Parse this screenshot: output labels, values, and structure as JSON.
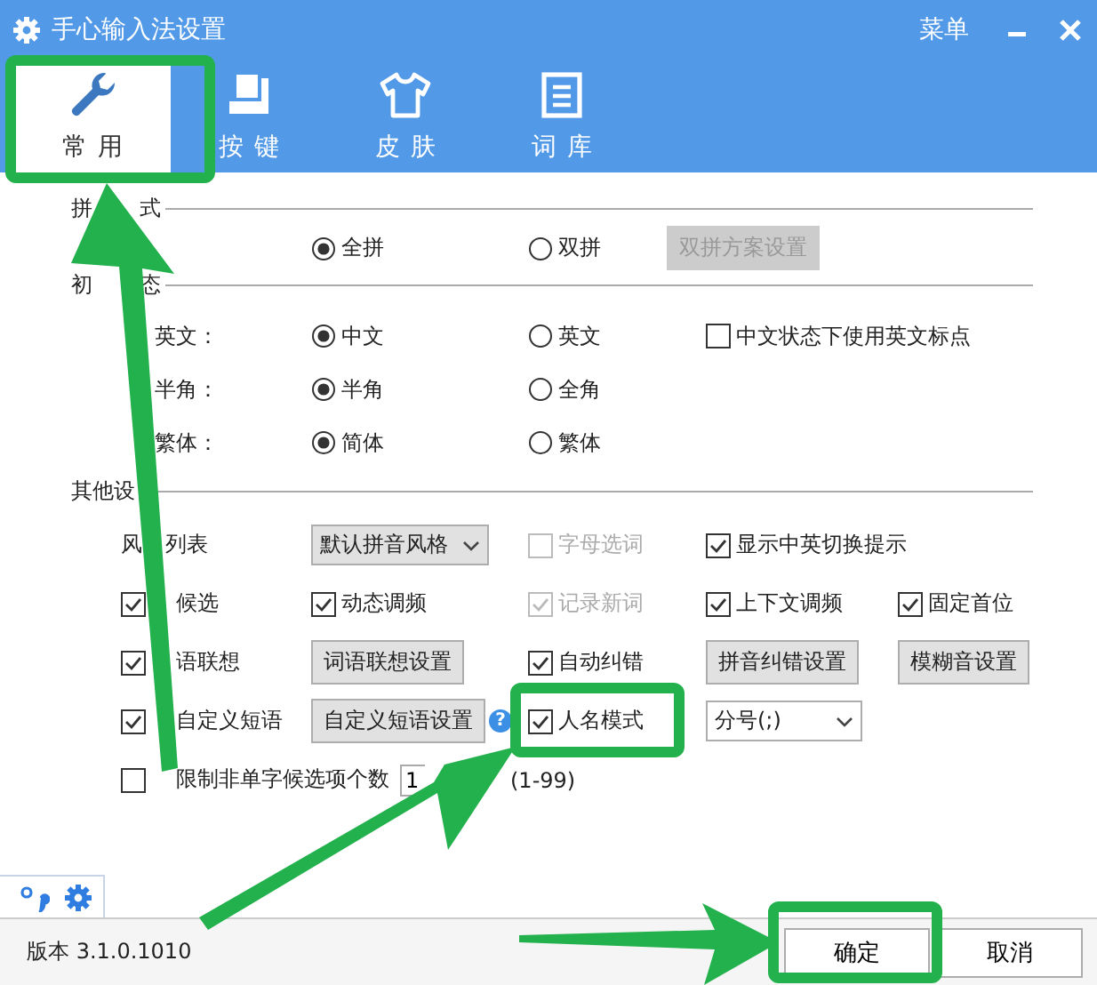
{
  "window": {
    "title": "手心输入法设置",
    "menu": "菜单"
  },
  "tabs": [
    {
      "label": "常用",
      "selected": true
    },
    {
      "label": "按键",
      "selected": false
    },
    {
      "label": "皮肤",
      "selected": false
    },
    {
      "label": "词库",
      "selected": false
    }
  ],
  "sections": [
    {
      "title": [
        "拼",
        "式"
      ],
      "rows": [
        {
          "cells": [
            {
              "kind": "radio",
              "label": "全拼",
              "selected": true
            },
            {
              "kind": "radio",
              "label": "双拼",
              "selected": false
            },
            {
              "kind": "button",
              "label": "双拼方案设置",
              "disabled": true
            }
          ]
        }
      ]
    },
    {
      "title": [
        "初",
        "态"
      ],
      "rows": [
        {
          "label": [
            "英文："
          ],
          "cells": [
            {
              "kind": "radio",
              "label": "中文",
              "selected": true
            },
            {
              "kind": "radio",
              "label": "英文",
              "selected": false
            },
            {
              "kind": "checkbox",
              "label": "中文状态下使用英文标点",
              "checked": false,
              "disabled": false
            }
          ]
        },
        {
          "label": [
            "半角："
          ],
          "cells": [
            {
              "kind": "radio",
              "label": "半角",
              "selected": true
            },
            {
              "kind": "radio",
              "label": "全角",
              "selected": false
            }
          ]
        },
        {
          "label": [
            "繁体："
          ],
          "cells": [
            {
              "kind": "radio",
              "label": "简体",
              "selected": true
            },
            {
              "kind": "radio",
              "label": "繁体",
              "selected": false
            }
          ]
        }
      ]
    },
    {
      "title": [
        "其他设"
      ],
      "rows": [
        {
          "cells": [
            {
              "kind": "label",
              "label": [
                "风",
                "列表"
              ]
            },
            {
              "kind": "select",
              "value": "默认拼音风格"
            },
            {
              "kind": "checkbox",
              "label": "字母选词",
              "checked": false,
              "disabled": true
            },
            {
              "kind": "checkbox",
              "label": "显示中英切换提示",
              "checked": true,
              "disabled": false
            }
          ]
        },
        {
          "cells": [
            {
              "kind": "checkbox",
              "label": "候选",
              "checked": true,
              "disabled": false
            },
            {
              "kind": "checkbox",
              "label": "动态调频",
              "checked": true,
              "disabled": false
            },
            {
              "kind": "checkbox",
              "label": "记录新词",
              "checked": true,
              "disabled": true
            },
            {
              "kind": "checkbox",
              "label": "上下文调频",
              "checked": true,
              "disabled": false
            },
            {
              "kind": "checkbox",
              "label": "固定首位",
              "checked": true,
              "disabled": false
            }
          ]
        },
        {
          "cells": [
            {
              "kind": "checkbox",
              "label": "语联想",
              "checked": true,
              "disabled": false
            },
            {
              "kind": "button",
              "label": "词语联想设置",
              "disabled": false
            },
            {
              "kind": "checkbox",
              "label": "自动纠错",
              "checked": true,
              "disabled": false
            },
            {
              "kind": "button",
              "label": "拼音纠错设置",
              "disabled": false
            },
            {
              "kind": "button",
              "label": "模糊音设置",
              "disabled": false
            }
          ]
        },
        {
          "cells": [
            {
              "kind": "checkbox",
              "label": "自定义短语",
              "checked": true,
              "disabled": false
            },
            {
              "kind": "button",
              "label": "自定义短语设置",
              "disabled": false,
              "help": "?"
            },
            {
              "kind": "checkbox",
              "label": "人名模式",
              "checked": true,
              "disabled": false
            },
            {
              "kind": "select",
              "value": "分号(;)"
            }
          ]
        },
        {
          "cells": [
            {
              "kind": "checkbox",
              "label": "限制非单字候选项个数",
              "checked": false,
              "disabled": false
            },
            {
              "kind": "number",
              "value": "1",
              "hint": "(1-99)"
            }
          ]
        }
      ]
    }
  ],
  "footer": {
    "version": "版本 3.1.0.1010",
    "buttons": [
      "确定",
      "取消"
    ]
  }
}
